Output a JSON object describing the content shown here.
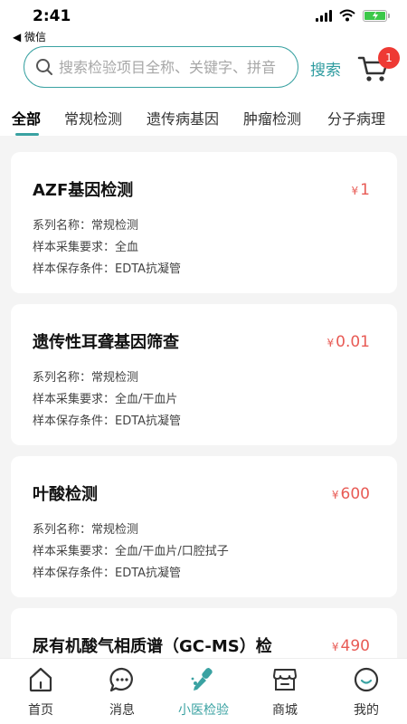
{
  "status_bar": {
    "time": "2:41",
    "back_app": "◀ 微信"
  },
  "search": {
    "placeholder": "搜索检验项目全称、关键字、拼音",
    "button_label": "搜索"
  },
  "cart": {
    "badge_count": "1"
  },
  "tabs": [
    {
      "label": "全部",
      "active": true
    },
    {
      "label": "常规检测"
    },
    {
      "label": "遗传病基因"
    },
    {
      "label": "肿瘤检测"
    },
    {
      "label": "分子病理"
    }
  ],
  "products": [
    {
      "name": "AZF基因检测",
      "price": "1",
      "series": "系列名称：常规检测",
      "sample": "样本采集要求：全血",
      "storage": "样本保存条件：EDTA抗凝管"
    },
    {
      "name": "遗传性耳聋基因筛查",
      "price": "0.01",
      "series": "系列名称：常规检测",
      "sample": "样本采集要求：全血/干血片",
      "storage": "样本保存条件：EDTA抗凝管"
    },
    {
      "name": "叶酸检测",
      "price": "600",
      "series": "系列名称：常规检测",
      "sample": "样本采集要求：全血/干血片/口腔拭子",
      "storage": "样本保存条件：EDTA抗凝管"
    },
    {
      "name": "尿有机酸气相质谱（GC-MS）检",
      "price": "490",
      "series": "",
      "sample": "",
      "storage": ""
    }
  ],
  "currency_symbol": "¥",
  "bottom_nav": [
    {
      "label": "首页",
      "icon": "home-icon"
    },
    {
      "label": "消息",
      "icon": "message-icon"
    },
    {
      "label": "小医检验",
      "icon": "pipette-icon",
      "active": true
    },
    {
      "label": "商城",
      "icon": "shop-icon"
    },
    {
      "label": "我的",
      "icon": "profile-icon"
    }
  ],
  "colors": {
    "accent": "#3aa2a2",
    "price": "#e85b55",
    "badge": "#ee3a34",
    "battery": "#3cc84a"
  }
}
